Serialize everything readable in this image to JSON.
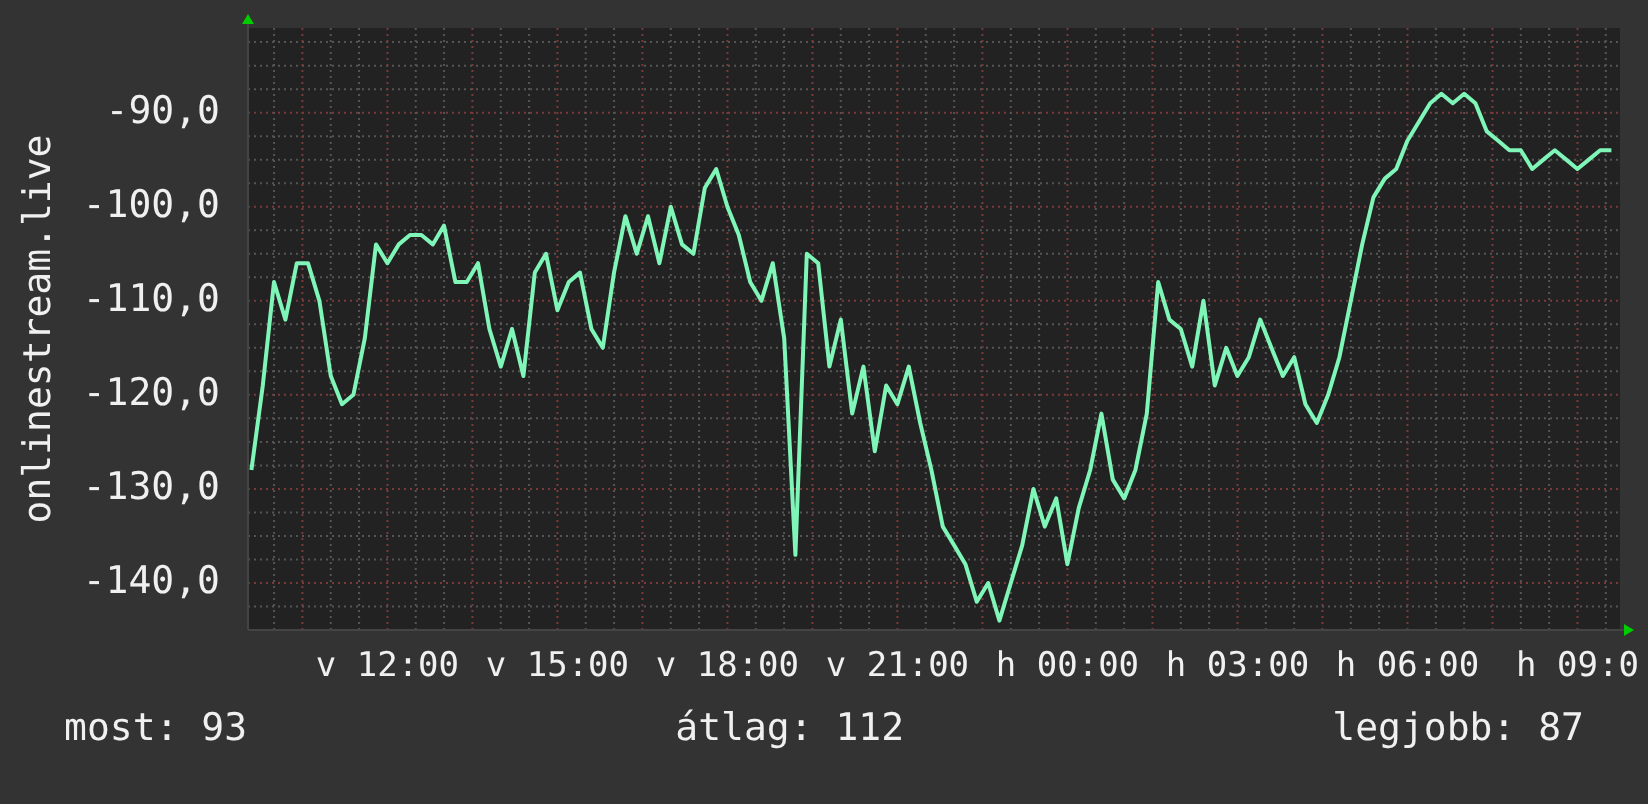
{
  "chart": {
    "chart_data": {
      "type": "line",
      "ylabel": "onlinestream.live",
      "categories": [
        null,
        null,
        null,
        null,
        null,
        null,
        null,
        null,
        null,
        null,
        null,
        null,
        "v 12:00",
        null,
        null,
        null,
        null,
        null,
        null,
        null,
        null,
        null,
        null,
        null,
        null,
        null,
        null,
        "v 15:00",
        null,
        null,
        null,
        null,
        null,
        null,
        null,
        null,
        null,
        null,
        null,
        null,
        null,
        null,
        "v 18:00",
        null,
        null,
        null,
        null,
        null,
        null,
        null,
        null,
        null,
        null,
        null,
        null,
        null,
        null,
        "v 21:00",
        null,
        null,
        null,
        null,
        null,
        null,
        null,
        null,
        null,
        null,
        null,
        null,
        null,
        null,
        "h 00:00",
        null,
        null,
        null,
        null,
        null,
        null,
        null,
        null,
        null,
        null,
        null,
        null,
        null,
        null,
        "h 03:00",
        null,
        null,
        null,
        null,
        null,
        null,
        null,
        null,
        null,
        null,
        null,
        null,
        null,
        null,
        "h 06:00",
        null,
        null,
        null,
        null,
        null,
        null,
        null,
        null,
        null,
        null,
        null,
        null,
        null,
        null,
        "h 09:0",
        null,
        null,
        null
      ],
      "series": [
        {
          "color": "#7ff5b8",
          "values": [
            -128,
            -119,
            -108,
            -112,
            -106,
            -106,
            -110,
            -118,
            -121,
            -120,
            -114,
            -104,
            -106,
            -104,
            -103,
            -103,
            -104,
            -102,
            -108,
            -108,
            -106,
            -113,
            -117,
            -113,
            -118,
            -107,
            -105,
            -111,
            -108,
            -107,
            -113,
            -115,
            -107,
            -101,
            -105,
            -101,
            -106,
            -100,
            -104,
            -105,
            -98,
            -96,
            -100,
            -103,
            -108,
            -110,
            -106,
            -114,
            -137,
            -105,
            -106,
            -117,
            -112,
            -122,
            -117,
            -126,
            -119,
            -121,
            -117,
            -123,
            -128,
            -134,
            -136,
            -138,
            -142,
            -140,
            -144,
            -140,
            -136,
            -130,
            -134,
            -131,
            -138,
            -132,
            -128,
            -122,
            -129,
            -131,
            -128,
            -122,
            -108,
            -112,
            -113,
            -117,
            -110,
            -119,
            -115,
            -118,
            -116,
            -112,
            -115,
            -118,
            -116,
            -121,
            -123,
            -120,
            -116,
            -110,
            -104,
            -99,
            -97,
            -96,
            -93,
            -91,
            -89,
            -88,
            -89,
            -88,
            -89,
            -92,
            -93,
            -94,
            -94,
            -96,
            -95,
            -94,
            -95,
            -96,
            -95,
            -94,
            -94
          ]
        }
      ],
      "grid": true,
      "ylim": [
        -145,
        -81
      ],
      "yticks": [
        {
          "value": -90,
          "label": "-90,0"
        },
        {
          "value": -100,
          "label": "-100,0"
        },
        {
          "value": -110,
          "label": "-110,0"
        },
        {
          "value": -120,
          "label": "-120,0"
        },
        {
          "value": -130,
          "label": "-130,0"
        },
        {
          "value": -140,
          "label": "-140,0"
        }
      ]
    }
  },
  "stats": [
    {
      "label": "most: 93"
    },
    {
      "label": "átlag: 112"
    },
    {
      "label": "legjobb: 87"
    }
  ]
}
